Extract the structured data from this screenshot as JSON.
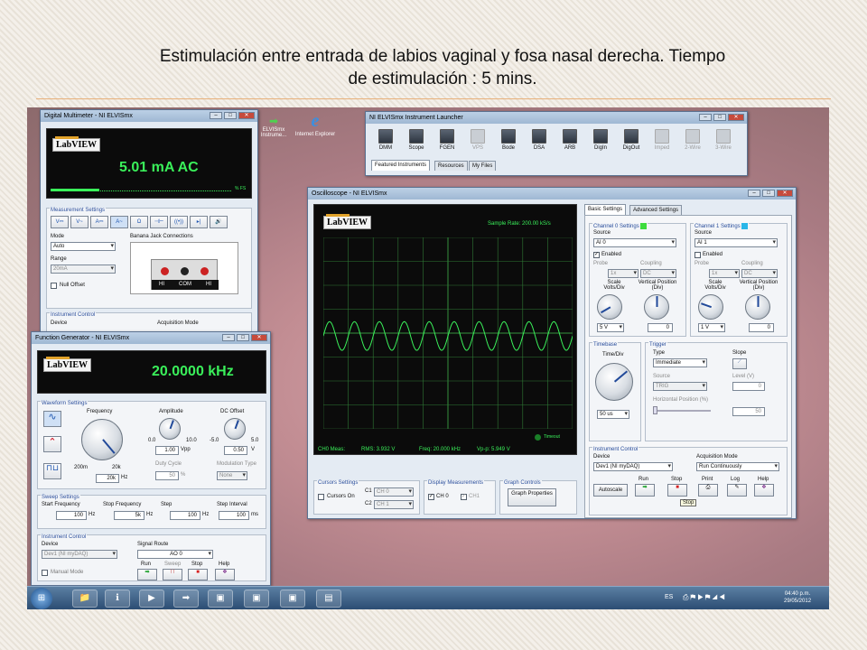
{
  "slide": {
    "title_line1": "Estimulación entre entrada de labios vaginal y fosa nasal derecha. Tiempo",
    "title_line2": "de estimulación : 5 mins."
  },
  "desktop_icons": [
    {
      "label": "ELVISmx Instrume...",
      "icon": "arrow-icon"
    },
    {
      "label": "Internet Explorer",
      "icon": "ie-icon"
    }
  ],
  "dmm": {
    "title": "Digital Multimeter - NI ELVISmx",
    "display": "5.01 mA AC",
    "scale_label": "% FS",
    "meas_settings": "Measurement Settings",
    "func_buttons": [
      "V⎓",
      "V~",
      "A⎓",
      "A~",
      "Ω",
      "⊣⊢",
      "((•))",
      "▸|",
      "🔊"
    ],
    "mode_label": "Mode",
    "mode_value": "Auto",
    "range_label": "Range",
    "range_value": "20mA",
    "null_offset": "Null Offset",
    "banana_label": "Banana Jack Connections",
    "jack_hi": "HI",
    "jack_com": "COM",
    "jack_hi2": "HI",
    "instrument_control": "Instrument Control",
    "device_label": "Device",
    "acq_label": "Acquisition Mode"
  },
  "fgen": {
    "title": "Function Generator - NI ELVISmx",
    "display": "20.0000 kHz",
    "waveform_settings": "Waveform Settings",
    "frequency": "Frequency",
    "freq_min": "200m",
    "freq_max": "20k",
    "freq_value": "20k",
    "freq_unit": "Hz",
    "amplitude": "Amplitude",
    "amp_min": "0.0",
    "amp_max": "10.0",
    "amp_value": "1.00",
    "amp_unit": "Vpp",
    "dc_offset": "DC Offset",
    "dc_min": "-5.0",
    "dc_max": "5.0",
    "dc_value": "0.50",
    "dc_unit": "V",
    "duty_cycle": "Duty Cycle",
    "duty_value": "50",
    "duty_unit": "%",
    "mod_type": "Modulation Type",
    "mod_value": "None",
    "sweep_settings": "Sweep Settings",
    "start_freq": "Start Frequency",
    "start_val": "100",
    "stop_freq": "Stop Frequency",
    "stop_val": "5k",
    "step": "Step",
    "step_val": "100",
    "step_interval": "Step Interval",
    "step_int_val": "100",
    "hz": "Hz",
    "ms": "ms",
    "instrument_control": "Instrument Control",
    "device_label": "Device",
    "device_value": "Dev1 (NI myDAQ)",
    "signal_route": "Signal Route",
    "route_value": "AO 0",
    "manual_mode": "Manual Mode",
    "run": "Run",
    "sweep": "Sweep",
    "stop": "Stop",
    "help": "Help"
  },
  "launcher": {
    "title": "NI ELVISmx Instrument Launcher",
    "tools": [
      "DMM",
      "Scope",
      "FGEN",
      "VPS",
      "Bode",
      "DSA",
      "ARB",
      "DigIn",
      "DigOut",
      "Imped",
      "2-Wire",
      "3-Wire"
    ],
    "tabs": [
      "Featured Instruments",
      "Resources",
      "My Files"
    ]
  },
  "scope": {
    "title": "Oscilloscope - NI ELVISmx",
    "sample_rate": "Sample Rate: 200.00 kS/s",
    "timeout": "Timeout",
    "ch0_meas": "CH0 Meas:",
    "rms": "RMS: 3.932 V",
    "freq": "Freq: 20.000 kHz",
    "vpp": "Vp-p: 5.949 V",
    "tabs": [
      "Basic Settings",
      "Advanced Settings"
    ],
    "ch0": {
      "title": "Channel 0 Settings",
      "source_label": "Source",
      "source": "AI 0",
      "enabled": "Enabled",
      "probe_label": "Probe",
      "probe": "1x",
      "coupling_label": "Coupling",
      "coupling": "DC",
      "scale_label": "Scale Volts/Div",
      "scale": "5 V",
      "vpos_label": "Vertical Position (Div)",
      "vpos": "0",
      "color": "#3ddc3d"
    },
    "ch1": {
      "title": "Channel 1 Settings",
      "source_label": "Source",
      "source": "AI 1",
      "enabled": "Enabled",
      "probe_label": "Probe",
      "probe": "1x",
      "coupling_label": "Coupling",
      "coupling": "DC",
      "scale_label": "Scale Volts/Div",
      "scale": "1 V",
      "vpos_label": "Vertical Position (Div)",
      "vpos": "0",
      "color": "#29b6e8"
    },
    "timebase": {
      "title": "Timebase",
      "label": "Time/Div",
      "value": "50 us"
    },
    "trigger": {
      "title": "Trigger",
      "type_label": "Type",
      "type": "Immediate",
      "slope_label": "Slope",
      "source_label": "Source",
      "source": "TRIG",
      "level_label": "Level (V)",
      "level": "0",
      "hpos_label": "Horizontal Position (%)",
      "hpos": "50"
    },
    "inst_control": {
      "title": "Instrument Control",
      "device_label": "Device",
      "device": "Dev1 (NI myDAQ)",
      "acq_label": "Acquisition Mode",
      "acq": "Run Continuously",
      "autoscale": "Autoscale",
      "run": "Run",
      "stop": "Stop",
      "print": "Print",
      "log": "Log",
      "help": "Help",
      "tooltip": "Stop"
    },
    "cursors": {
      "title": "Cursors Settings",
      "cursors_on": "Cursors On",
      "c1": "C1",
      "c1_val": "CH 0",
      "c2": "C2",
      "c2_val": "CH 1"
    },
    "display_meas": {
      "title": "Display Measurements",
      "ch0": "CH 0",
      "ch1": "CH1"
    },
    "graph_controls": {
      "title": "Graph Controls",
      "button": "Graph Properties"
    }
  },
  "taskbar": {
    "lang": "ES",
    "time": "04:40 p.m.",
    "date": "29/05/2012"
  }
}
